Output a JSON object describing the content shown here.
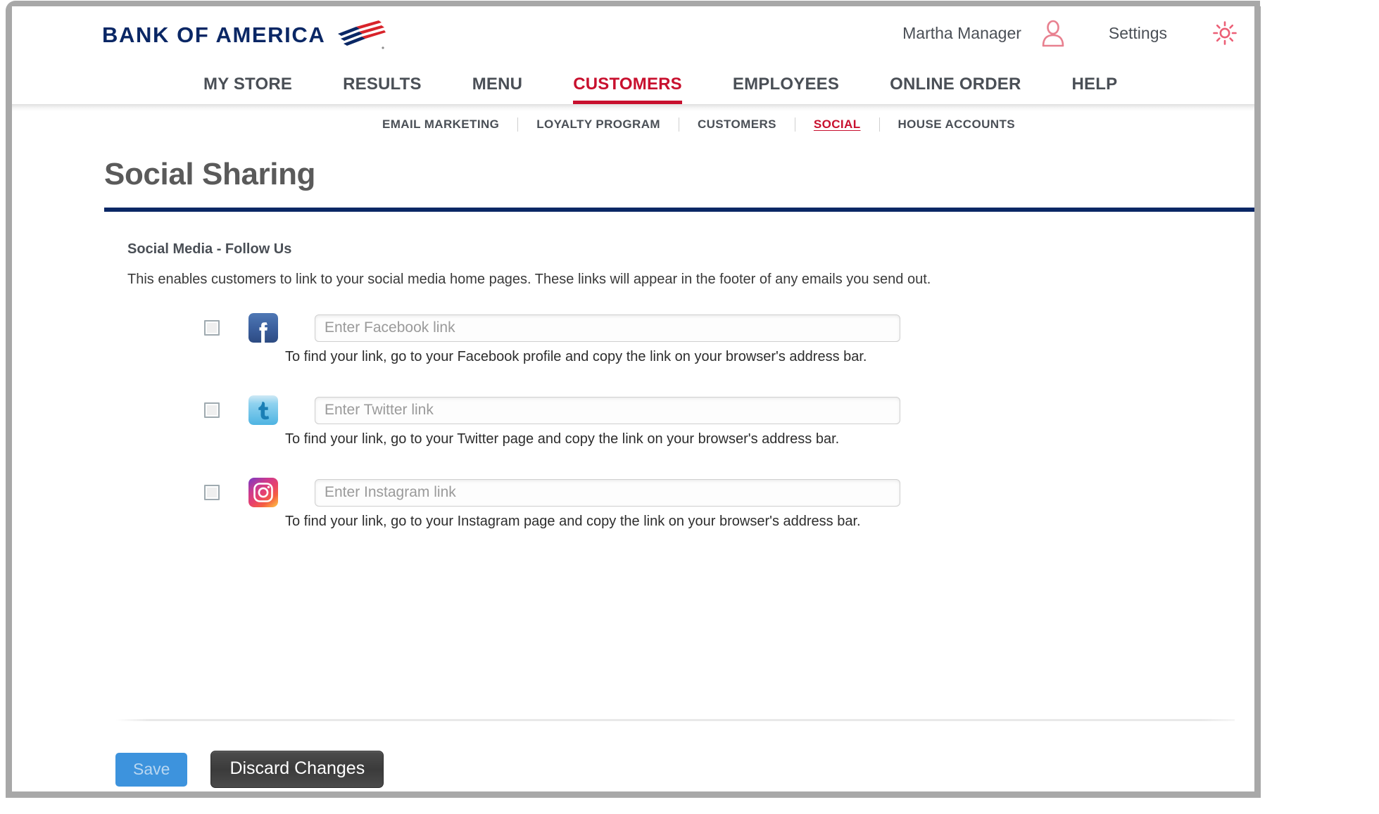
{
  "brand": {
    "logo_text": "BANK OF AMERICA",
    "logo_flag_icon": "bofa-flag-icon",
    "navy": "#0a2765",
    "red": "#c8102e"
  },
  "header": {
    "user_name": "Martha Manager",
    "user_icon": "person-icon",
    "settings_label": "Settings",
    "settings_icon": "gear-icon"
  },
  "main_nav": {
    "items": [
      {
        "label": "MY STORE",
        "active": false
      },
      {
        "label": "RESULTS",
        "active": false
      },
      {
        "label": "MENU",
        "active": false
      },
      {
        "label": "CUSTOMERS",
        "active": true
      },
      {
        "label": "EMPLOYEES",
        "active": false
      },
      {
        "label": "ONLINE ORDER",
        "active": false
      },
      {
        "label": "HELP",
        "active": false
      }
    ]
  },
  "sub_nav": {
    "items": [
      {
        "label": "EMAIL MARKETING",
        "active": false
      },
      {
        "label": "LOYALTY PROGRAM",
        "active": false
      },
      {
        "label": "CUSTOMERS",
        "active": false
      },
      {
        "label": "SOCIAL",
        "active": true
      },
      {
        "label": "HOUSE ACCOUNTS",
        "active": false
      }
    ]
  },
  "page": {
    "title": "Social Sharing"
  },
  "section": {
    "heading": "Social Media - Follow Us",
    "description": "This enables customers to link to your social media home pages. These links will appear in the footer of any emails you send out."
  },
  "social_rows": [
    {
      "network": "facebook",
      "icon": "facebook-icon",
      "checked": false,
      "value": "",
      "placeholder": "Enter Facebook link",
      "help": "To find your link, go to your Facebook profile and copy the link on your browser's address bar."
    },
    {
      "network": "twitter",
      "icon": "twitter-icon",
      "checked": false,
      "value": "",
      "placeholder": "Enter Twitter link",
      "help": "To find your link, go to your Twitter page and copy the link on your browser's address bar."
    },
    {
      "network": "instagram",
      "icon": "instagram-icon",
      "checked": false,
      "value": "",
      "placeholder": "Enter Instagram link",
      "help": "To find your link, go to your Instagram page and copy the link on your browser's address bar."
    }
  ],
  "footer": {
    "save_label": "Save",
    "save_enabled": false,
    "discard_label": "Discard Changes"
  }
}
